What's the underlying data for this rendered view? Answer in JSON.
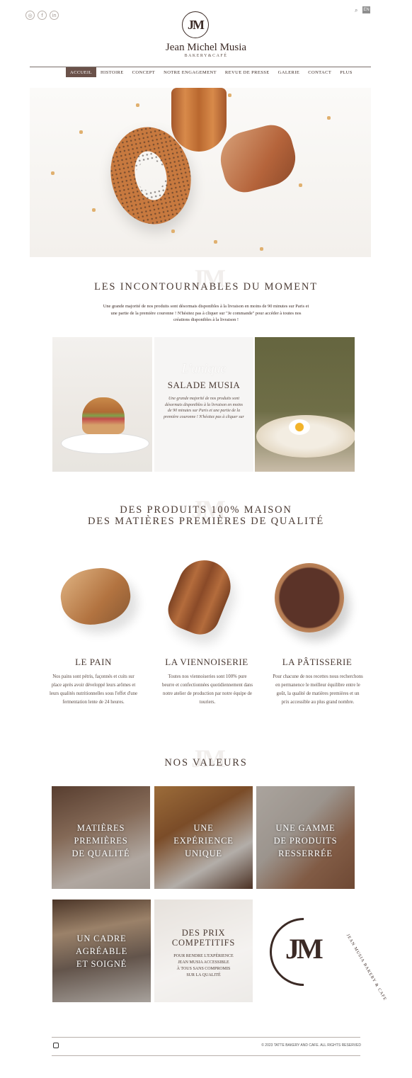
{
  "header": {
    "social": [
      "instagram-icon",
      "facebook-icon",
      "linkedin-icon"
    ],
    "social_glyphs": [
      "◎",
      "f",
      "in"
    ],
    "search_glyph": "⌕",
    "lang": "EN",
    "logo_mark": "JM",
    "brand": "Jean Michel Musia",
    "brand_sub": "BAKERY&CAFÉ"
  },
  "nav": [
    "ACCUEIL",
    "HISTOIRE",
    "CONCEPT",
    "NOTRE ENGAGEMENT",
    "REVUE DE PRESSE",
    "GALERIE",
    "CONTACT",
    "PLUS"
  ],
  "incontournables": {
    "title": "LES INCONTOURNABLES DU MOMENT",
    "text": "Une grande majorité de nos produits sont désormais disponibles à la livraison en moins de 90 minutes sur Paris et une partie de la première couronne ! N'hésitez pas à cliquer sur \"Je commande\" pour accéder à toutes nos créations disponibles à la livraison !",
    "feature_script": "L'unique",
    "feature_title": "SALADE MUSIA",
    "feature_text": "Une grande majorité de nos produits sont désormais disponibles à la livraison en moins de 90 minutes sur Paris et une partie de la première couronne ! N'hésitez pas à cliquer sur"
  },
  "produits": {
    "title_1": "DES PRODUITS 100% MAISON",
    "title_2": "DES MATIÈRES PREMIÈRES DE QUALITÉ",
    "items": [
      {
        "title": "LE PAIN",
        "text": "Nos pains sont pétris, façonnés et cuits sur place après avoir développé leurs arômes et leurs qualités nutritionnelles sous l'effet d'une fermentation lente de 24 heures."
      },
      {
        "title": "LA VIENNOISERIE",
        "text": "Toutes nos viennoiseries sont 100% pure beurre et confectionnées quotidiennement dans notre atelier de production par notre équipe de touriers."
      },
      {
        "title": "LA PÂTISSERIE",
        "text": "Pour chacune de nos recettes nous recherchons en permanence le meilleur équilibre entre le goût, la qualité de matières premières et un prix accessible au plus grand nombre."
      }
    ]
  },
  "valeurs": {
    "title": "NOS VALEURS",
    "items": [
      {
        "l1": "MATIÈRES",
        "l2": "PREMIÈRES",
        "l3": "DE QUALITÉ"
      },
      {
        "l1": "UNE",
        "l2": "EXPÉRIENCE",
        "l3": "UNIQUE"
      },
      {
        "l1": "UNE GAMME",
        "l2": "DE PRODUITS",
        "l3": "RESSERRÉE"
      },
      {
        "l1": "UN CADRE",
        "l2": "AGRÉABLE",
        "l3": "ET SOIGNÉ"
      },
      {
        "l1": "DES PRIX",
        "l2": "COMPETITIFS",
        "l3": "POUR RENDRE L'EXPÉRIENCE",
        "l4": "JEAN MUSIA ACCESSIBLE",
        "l5": "À TOUS SANS COMPROMIS",
        "l6": "SUR LA QUALITÉ"
      }
    ],
    "logo_mark": "JM",
    "logo_ring_text": "JEAN MUSIA BAKERY & CAFE"
  },
  "footer": {
    "instagram": "instagram-icon",
    "copyright": "© 2023 TATTE BAKERY AND CAFE. ALL RIGHTS RESERVED"
  }
}
